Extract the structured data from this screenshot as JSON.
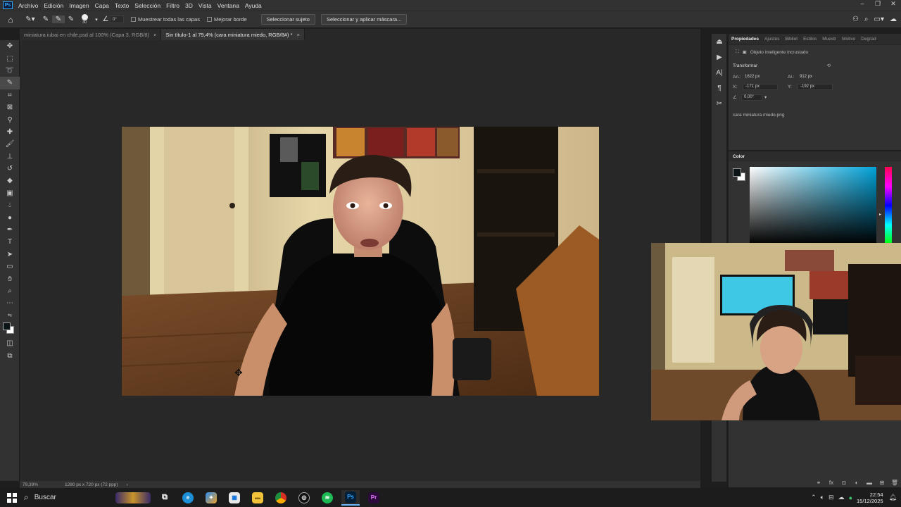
{
  "menubar": {
    "app_icon": "Ps",
    "items": [
      "Archivo",
      "Edición",
      "Imagen",
      "Capa",
      "Texto",
      "Selección",
      "Filtro",
      "3D",
      "Vista",
      "Ventana",
      "Ayuda"
    ]
  },
  "options": {
    "brush_size": "30",
    "angle": "0°",
    "sample_all_layers": "Muestrear todas las capas",
    "enhance_edge": "Mejorar borde",
    "select_subject": "Seleccionar sujeto",
    "select_and_mask": "Seleccionar y aplicar máscara..."
  },
  "tabs": [
    {
      "label": "miniatura iubai en chile.psd al 100% (Capa 3, RGB/8)",
      "active": false
    },
    {
      "label": "Sin título-1 al 79,4% (cara miniatura miedo, RGB/8#) *",
      "active": true
    }
  ],
  "status": {
    "zoom": "79,39%",
    "doc_size": "1280 px x 720 px (72 ppp)"
  },
  "properties": {
    "tabs": [
      "Propiedades",
      "Ajustes",
      "Bibliot",
      "Estilos",
      "Muestr",
      "Motivo",
      "Degrad"
    ],
    "object_type": "Objeto inteligente incrustado",
    "section_transform": "Transformar",
    "width_label": "An.:",
    "width_value": "1622 px",
    "height_label": "Al.:",
    "height_value": "912 px",
    "x_label": "X:",
    "x_value": "-171 px",
    "y_label": "Y:",
    "y_value": "-192 px",
    "angle_value": "0,00°",
    "filename": "cara miniatura miedo.png"
  },
  "color_panel": {
    "title": "Color",
    "fg": "#0b1416",
    "bg": "#ffffff",
    "hue": "#00a2d8"
  },
  "taskbar": {
    "search_label": "Buscar",
    "time": "22:54",
    "date": "15/12/2025"
  }
}
